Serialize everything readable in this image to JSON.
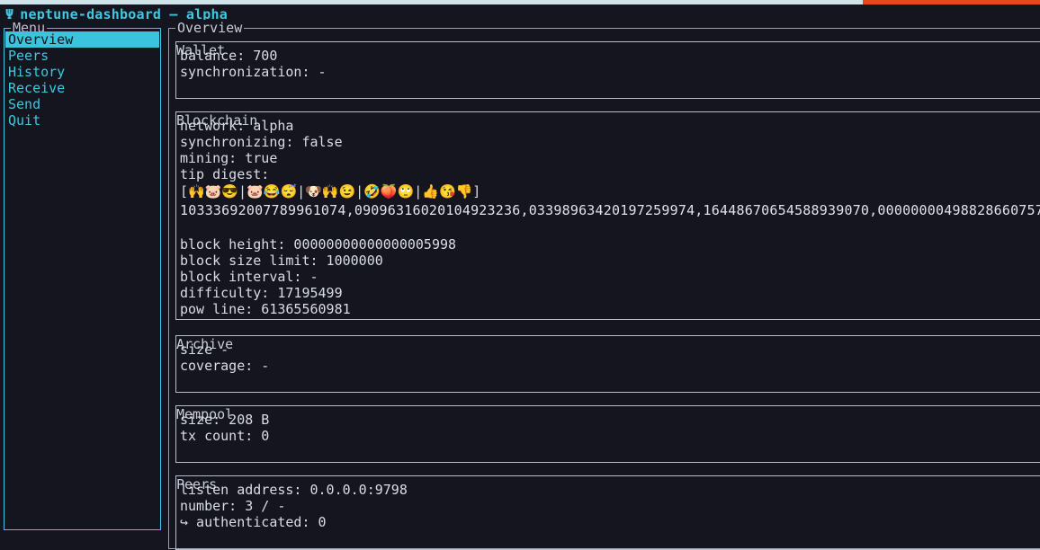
{
  "window": {
    "title": "neptune-dashboard — alpha",
    "trident_icon": "Ψ",
    "progress": {
      "done_percent": 83,
      "done_color": "#cfe4e8",
      "remaining_color": "#e8481c"
    }
  },
  "theme": {
    "background": "#15151f",
    "accent_cyan": "#3fc7e0",
    "selection_bg": "#3bc4dd",
    "selection_fg": "#11111a",
    "border": "#b8bec9",
    "text": "#d9dde4"
  },
  "sidebar": {
    "title": "Menu",
    "items": [
      {
        "label": "Overview",
        "selected": true
      },
      {
        "label": "Peers",
        "selected": false
      },
      {
        "label": "History",
        "selected": false
      },
      {
        "label": "Receive",
        "selected": false
      },
      {
        "label": "Send",
        "selected": false
      },
      {
        "label": "Quit",
        "selected": false
      }
    ]
  },
  "main": {
    "title": "Overview",
    "sections": {
      "wallet": {
        "title": "Wallet",
        "balance": "balance: 700",
        "synchronization": "synchronization: -"
      },
      "blockchain": {
        "title": "Blockchain",
        "network": "network: alpha",
        "synchronizing": "synchronizing: false",
        "mining": "mining: true",
        "tip_digest_label": "tip digest:",
        "tip_digest_emoji": "[🙌🐷😎|🐷😂😴|🐶🙌😉|🤣🍑🙄|👍😘👎]",
        "tip_digest_numbers": "10333692007789961074,09096316020104923236,03398963420197259974,16448670654588939070,00000000498828660757",
        "block_height": "block height: 00000000000000005998",
        "block_size_limit": "block size limit: 1000000",
        "block_interval": "block interval: -",
        "difficulty": "difficulty: 17195499",
        "pow_line": "pow line: 61365560981"
      },
      "archive": {
        "title": "Archive",
        "size": "size -",
        "coverage": "coverage: -"
      },
      "mempool": {
        "title": "Mempool",
        "size": "size: 208 B",
        "tx_count": "tx count: 0"
      },
      "peers": {
        "title": "Peers",
        "listen_address": "listen address: 0.0.0.0:9798",
        "number": "number: 3 / -",
        "authenticated": "↪ authenticated: 0"
      }
    }
  }
}
